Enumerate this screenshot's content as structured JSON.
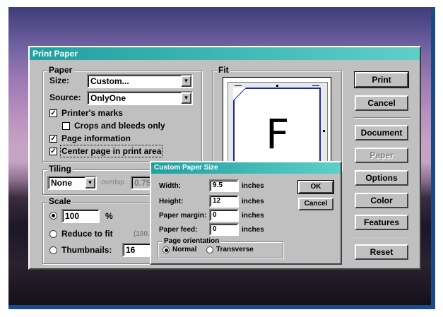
{
  "main_dialog": {
    "title": "Print Paper",
    "paper": {
      "group_label": "Paper",
      "size_label": "Size:",
      "size_value": "Custom...",
      "source_label": "Source:",
      "source_value": "OnlyOne",
      "printers_marks": {
        "label": "Printer's marks",
        "checked": true
      },
      "crops_bleeds": {
        "label": "Crops and bleeds only",
        "checked": false
      },
      "page_info": {
        "label": "Page information",
        "checked": true
      },
      "center_page": {
        "label": "Center page in print area",
        "checked": true
      }
    },
    "tiling": {
      "group_label": "Tiling",
      "mode_value": "None",
      "overlap_label": "overlap",
      "overlap_value": "0.75"
    },
    "scale": {
      "group_label": "Scale",
      "percent_value": "100",
      "percent_unit": "%",
      "reduce_label": "Reduce to fit",
      "reduce_value": "(100.0",
      "thumbnails_label": "Thumbnails:",
      "thumbnails_value": "16",
      "selected": "percent"
    },
    "fit": {
      "group_label": "Fit",
      "preview_letter": "F"
    },
    "buttons": {
      "print": "Print",
      "cancel": "Cancel",
      "document": "Document",
      "paper": "Paper",
      "options": "Options",
      "color": "Color",
      "features": "Features",
      "reset": "Reset"
    }
  },
  "custom_dialog": {
    "title": "Custom Paper Size",
    "width_label": "Width:",
    "width_value": "9.5",
    "height_label": "Height:",
    "height_value": "12",
    "margin_label": "Paper margin:",
    "margin_value": "0",
    "feed_label": "Paper feed:",
    "feed_value": "0",
    "unit": "inches",
    "ok": "OK",
    "cancel": "Cancel",
    "orientation": {
      "group_label": "Page orientation",
      "normal": "Normal",
      "transverse": "Transverse",
      "selected": "normal"
    }
  },
  "colors": {
    "titlebar_start": "#1f9f9f",
    "titlebar_end": "#5fcfc8",
    "dialog_face": "#c0c0c0",
    "preview_border": "#1a2a9a"
  }
}
